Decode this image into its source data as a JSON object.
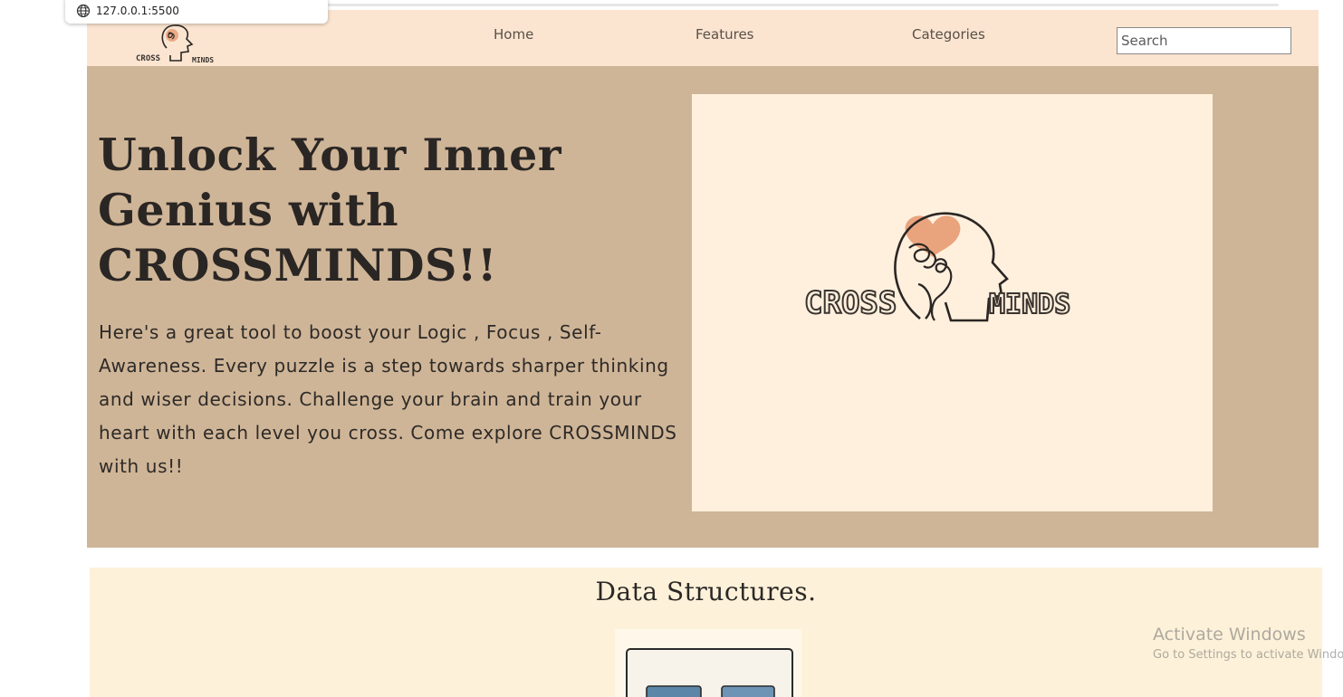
{
  "browser": {
    "url_tooltip": "127.0.0.1:5500",
    "globe_icon": "globe-icon"
  },
  "nav": {
    "logo_alt": "CROSS MINDS",
    "links": [
      {
        "label": "Home"
      },
      {
        "label": "Features"
      },
      {
        "label": "Categories"
      }
    ],
    "search": {
      "placeholder": "Search",
      "value": ""
    }
  },
  "hero": {
    "title": "Unlock Your Inner Genius with CROSSMINDS!!",
    "description": "Here's a great tool to boost your Logic , Focus , Self-Awareness. Every puzzle is a step towards sharper thinking and wiser decisions. Challenge your brain and train your heart with each level you cross. Come explore CROSSMINDS with us!!",
    "logo_text_left": "CROSS",
    "logo_text_right": "MINDS"
  },
  "section": {
    "title": "Data Structures."
  },
  "watermark": {
    "line1": "Activate Windows",
    "line2": "Go to Settings to activate Windows."
  },
  "colors": {
    "nav_bg": "#fbe5d0",
    "hero_bg": "#cfb597",
    "hero_image_bg": "#fff0dd",
    "section_bg": "#fdf1d9",
    "heart": "#e8a07a"
  }
}
